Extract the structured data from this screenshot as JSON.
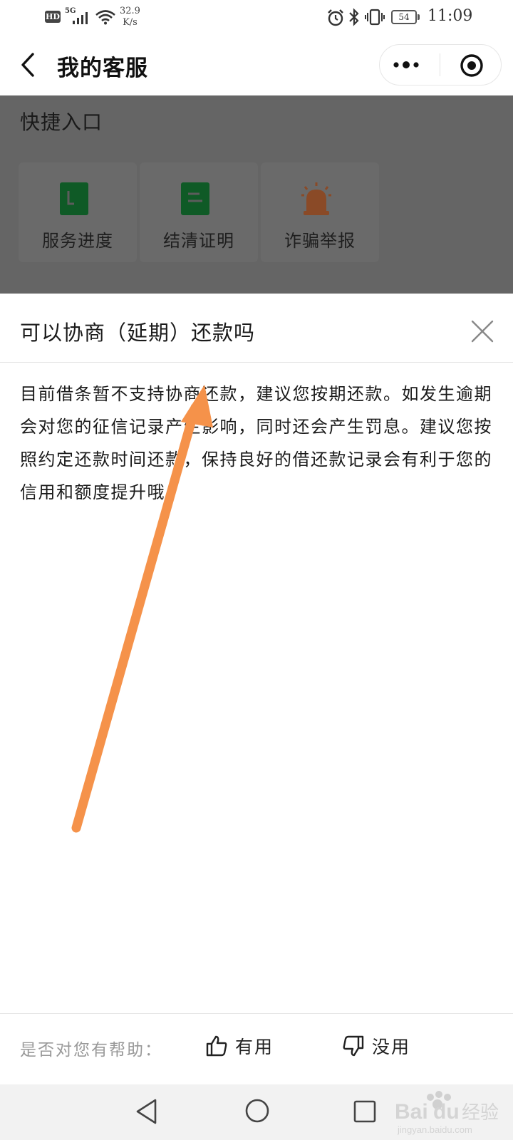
{
  "status_bar": {
    "hd": "HD",
    "network": "5G",
    "speed_value": "32.9",
    "speed_unit": "K/s",
    "battery": "54",
    "time": "11:09"
  },
  "header": {
    "title": "我的客服"
  },
  "quick_entry": {
    "title": "快捷入口",
    "items": [
      {
        "label": "服务进度",
        "icon": "document-progress-icon",
        "color": "#0f5a26"
      },
      {
        "label": "结清证明",
        "icon": "certificate-icon",
        "color": "#0f5a26"
      },
      {
        "label": "诈骗举报",
        "icon": "alarm-light-icon",
        "color": "#8a4a27"
      }
    ]
  },
  "sheet": {
    "title": "可以协商（延期）还款吗",
    "answer": "目前借条暂不支持协商还款，建议您按期还款。如发生逾期会对您的征信记录产生影响，同时还会产生罚息。建议您按照约定还款时间还款，保持良好的借还款记录会有利于您的信用和额度提升哦。"
  },
  "feedback": {
    "question": "是否对您有帮助：",
    "useful": "有用",
    "useless": "没用"
  },
  "colors": {
    "overlay": "#656565",
    "arrow": "#f5924a"
  }
}
